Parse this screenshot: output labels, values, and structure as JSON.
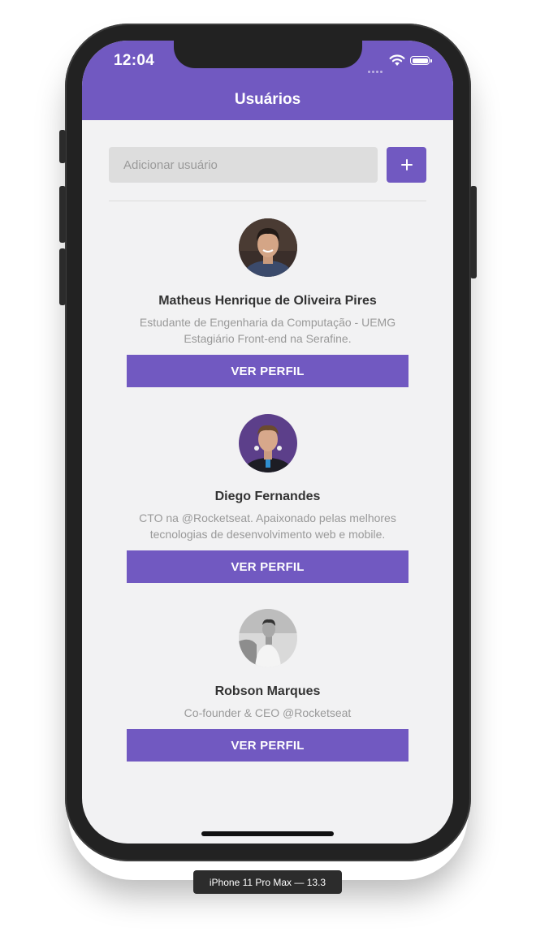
{
  "status_bar": {
    "time": "12:04"
  },
  "header": {
    "title": "Usuários"
  },
  "form": {
    "placeholder": "Adicionar usuário",
    "add_label": "+"
  },
  "users": [
    {
      "name": "Matheus Henrique de Oliveira Pires",
      "bio": "Estudante de Engenharia da Computação - UEMG Estagiário Front-end na Serafine.",
      "button": "VER PERFIL"
    },
    {
      "name": "Diego Fernandes",
      "bio": "CTO na @Rocketseat. Apaixonado pelas melhores tecnologias de desenvolvimento web e mobile.",
      "button": "VER PERFIL"
    },
    {
      "name": "Robson Marques",
      "bio": "Co-founder & CEO @Rocketseat",
      "button": "VER PERFIL"
    }
  ],
  "device_label": "iPhone 11 Pro Max — 13.3",
  "colors": {
    "primary": "#7159c1",
    "background": "#f2f2f3",
    "input": "#dddddd"
  }
}
